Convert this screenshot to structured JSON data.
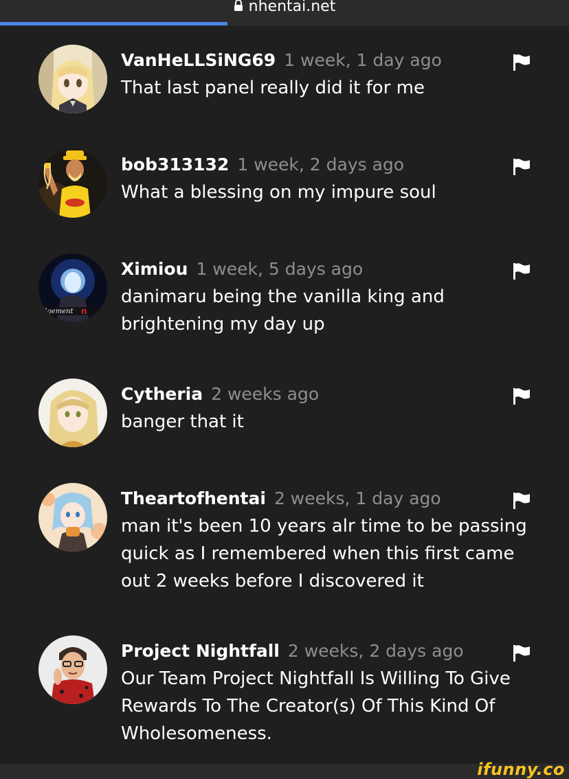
{
  "browser": {
    "url": "nhentai.net",
    "load_progress": 0.4
  },
  "comments": [
    {
      "username": "VanHeLLSiNG69",
      "time": "1 week, 1 day ago",
      "text": "That last panel really did it for me",
      "avatar": "anime-blonde-girl-avatar"
    },
    {
      "username": "bob313132",
      "time": "1 week, 2 days ago",
      "text": "What a blessing on my impure soul",
      "avatar": "wrestler-avatar"
    },
    {
      "username": "Ximiou",
      "time": "1 week, 5 days ago",
      "text": "danimaru being the vanilla king and brightening my day up",
      "avatar": "judgement-glow-avatar"
    },
    {
      "username": "Cytheria",
      "time": "2 weeks ago",
      "text": "banger that it",
      "avatar": "blonde-girl-avatar"
    },
    {
      "username": "Theartofhentai",
      "time": "2 weeks, 1 day ago",
      "text": "man it's been 10 years alr time to be passing quick as I remembered when this first came out 2 weeks before I discovered it",
      "avatar": "blue-hair-girl-avatar"
    },
    {
      "username": "Project Nightfall",
      "time": "2 weeks, 2 days ago",
      "text": "Our Team Project Nightfall Is Willing To Give Rewards To The Creator(s) Of This Kind Of Wholesomeness.",
      "avatar": "man-red-shirt-avatar"
    }
  ],
  "watermark": "ifunny.co",
  "colors": {
    "background": "#1f1f1f",
    "username": "#ffffff",
    "timestamp": "#8e8e8e",
    "progress": "#4a86e8",
    "watermark": "#f7c224"
  },
  "icons": {
    "flag": "flag-icon",
    "lock": "lock-icon"
  }
}
